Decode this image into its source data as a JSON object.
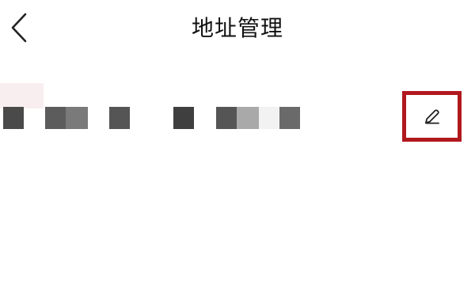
{
  "header": {
    "title": "地址管理",
    "back_icon": "chevron-left-icon"
  },
  "address": {
    "text_redacted": true,
    "edit_icon": "pencil-icon",
    "highlight_color": "#b0191e"
  }
}
